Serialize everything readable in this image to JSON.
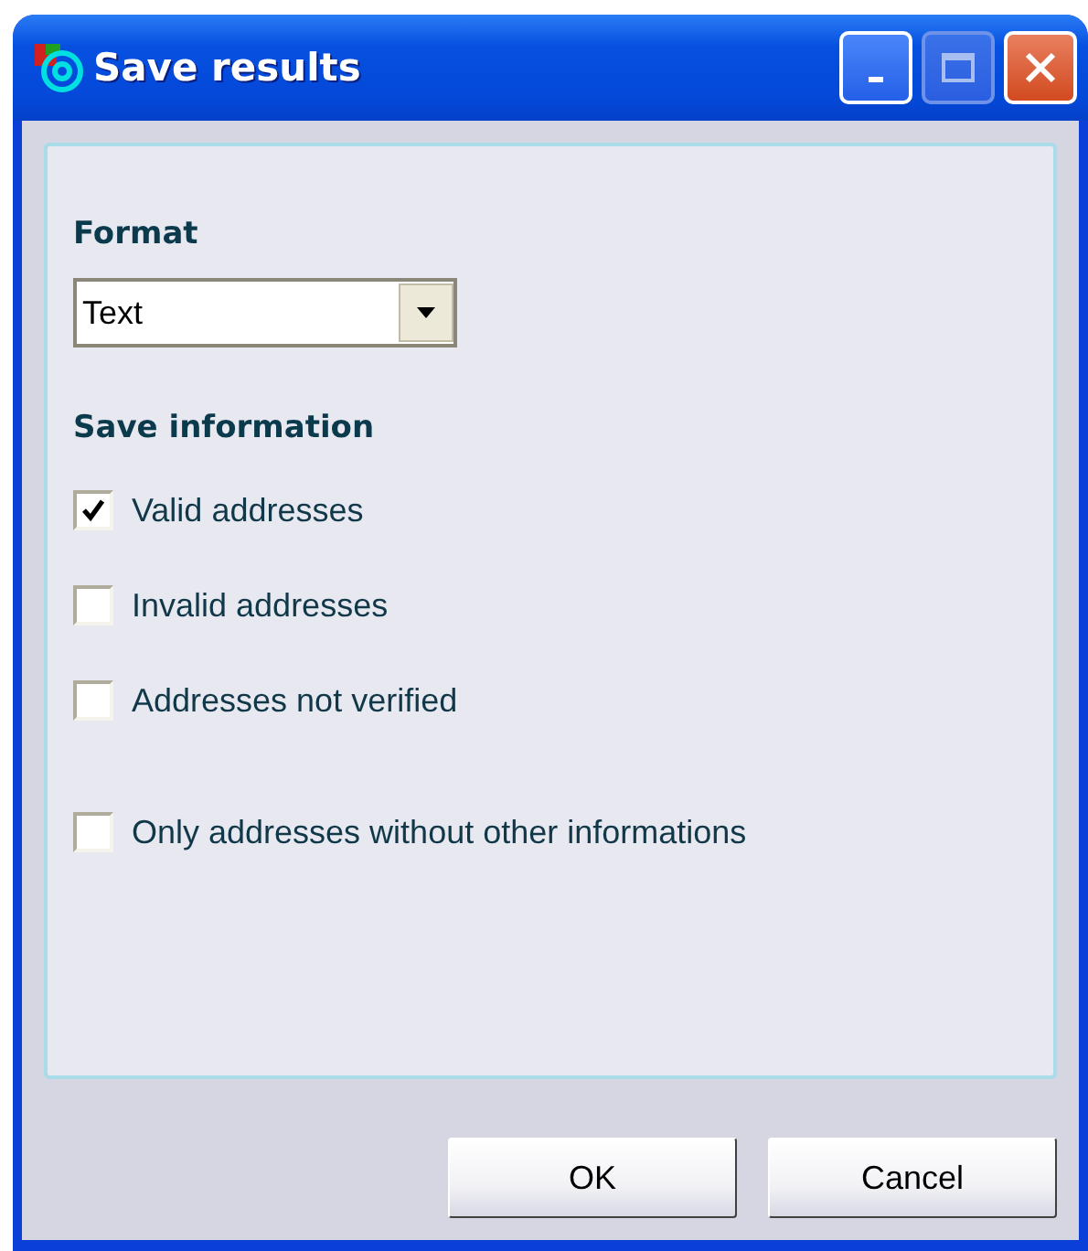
{
  "window": {
    "title": "Save results"
  },
  "format": {
    "label": "Format",
    "value": "Text"
  },
  "save_information": {
    "label": "Save information",
    "options": [
      {
        "label": "Valid addresses",
        "checked": true
      },
      {
        "label": "Invalid addresses",
        "checked": false
      },
      {
        "label": "Addresses not verified",
        "checked": false
      },
      {
        "label": "Only addresses without other informations",
        "checked": false
      }
    ]
  },
  "buttons": [
    "OK",
    "Cancel"
  ]
}
